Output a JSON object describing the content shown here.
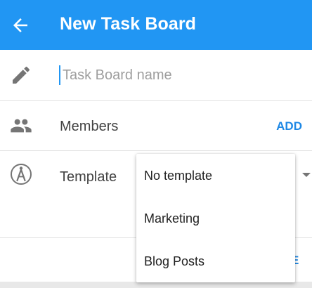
{
  "appbar": {
    "title": "New Task Board",
    "back_icon": "arrow-back-icon",
    "background": "#2196F3"
  },
  "name_row": {
    "icon": "pencil-icon",
    "placeholder": "Task Board name",
    "value": ""
  },
  "members_row": {
    "icon": "people-icon",
    "label": "Members",
    "add_label": "ADD"
  },
  "template_row": {
    "icon": "compass-icon",
    "label": "Template",
    "dropdown_icon": "dropdown-arrow-icon"
  },
  "template_menu": {
    "options": [
      "No template",
      "Marketing",
      "Blog Posts"
    ]
  },
  "bottom": {
    "button_label": "E"
  },
  "colors": {
    "accent": "#2196F3",
    "action_text": "#1e88e5"
  }
}
